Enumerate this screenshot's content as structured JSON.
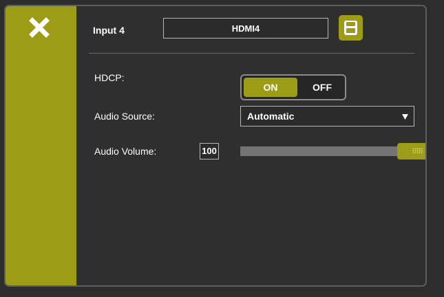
{
  "colors": {
    "accent": "#9c9c16",
    "background": "#2d2d2d",
    "border": "#5e5e5e"
  },
  "sidebar": {
    "close_icon": "close-icon"
  },
  "header": {
    "title": "Input 4",
    "name_value": "HDMI4",
    "save_icon": "save-icon"
  },
  "settings": {
    "hdcp": {
      "label": "HDCP:",
      "on_label": "ON",
      "off_label": "OFF",
      "selected": "ON"
    },
    "audio_source": {
      "label": "Audio Source:",
      "value": "Automatic"
    },
    "audio_volume": {
      "label": "Audio Volume:",
      "value": "100",
      "level_percent": 100
    }
  }
}
